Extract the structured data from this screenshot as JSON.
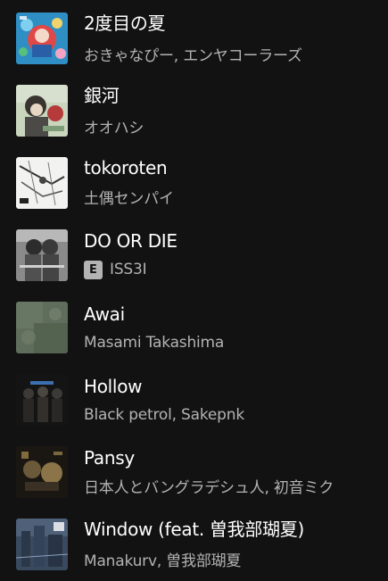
{
  "tracks": [
    {
      "title": "2度目の夏",
      "artists": "おきゃなぴー, エンヤコーラーズ",
      "explicit": false
    },
    {
      "title": "銀河",
      "artists": "オオハシ",
      "explicit": false
    },
    {
      "title": "tokoroten",
      "artists": "土偶センパイ",
      "explicit": false
    },
    {
      "title": "DO OR DIE",
      "artists": "ISS3I",
      "explicit": true,
      "explicit_label": "E"
    },
    {
      "title": "Awai",
      "artists": "Masami Takashima",
      "explicit": false
    },
    {
      "title": "Hollow",
      "artists": "Black petrol, Sakepnk",
      "explicit": false
    },
    {
      "title": "Pansy",
      "artists": "日本人とバングラデシュ人, 初音ミク",
      "explicit": false
    },
    {
      "title": "Window (feat. 曽我部瑚夏)",
      "artists": "Manakurv, 曽我部瑚夏",
      "explicit": false
    }
  ],
  "colors": {
    "background": "#121212",
    "title": "#ffffff",
    "subtitle": "#b3b3b3"
  }
}
